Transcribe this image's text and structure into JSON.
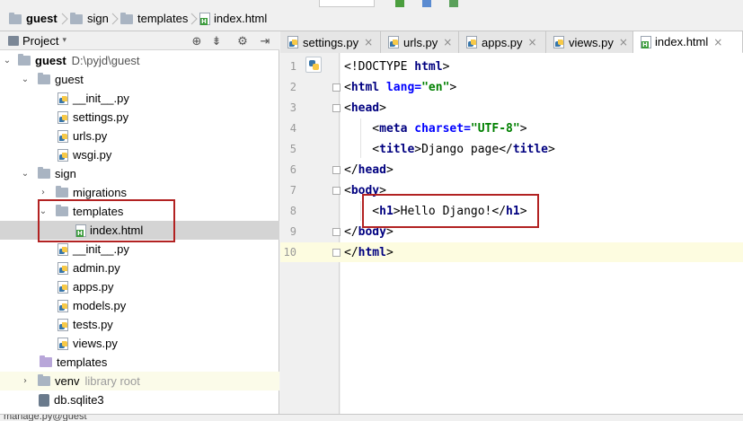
{
  "breadcrumb": {
    "items": [
      {
        "label": "guest",
        "bold": true,
        "icon": "folder-icon"
      },
      {
        "label": "sign",
        "icon": "folder-icon"
      },
      {
        "label": "templates",
        "icon": "folder-icon"
      },
      {
        "label": "index.html",
        "icon": "html-file-icon"
      }
    ]
  },
  "project_panel": {
    "title": "Project",
    "toolbar_icons": [
      "target-icon",
      "collapse-icon",
      "gear-icon",
      "hide-icon"
    ],
    "tree": [
      {
        "label": "guest",
        "extra": "D:\\pyjd\\guest",
        "depth": 0,
        "expanded": true,
        "icon": "folder-icon",
        "bold": true
      },
      {
        "label": "guest",
        "depth": 1,
        "expanded": true,
        "icon": "folder-icon"
      },
      {
        "label": "__init__.py",
        "depth": 2,
        "icon": "python-file-icon"
      },
      {
        "label": "settings.py",
        "depth": 2,
        "icon": "python-file-icon"
      },
      {
        "label": "urls.py",
        "depth": 2,
        "icon": "python-file-icon"
      },
      {
        "label": "wsgi.py",
        "depth": 2,
        "icon": "python-file-icon"
      },
      {
        "label": "sign",
        "depth": 1,
        "expanded": true,
        "icon": "folder-icon"
      },
      {
        "label": "migrations",
        "depth": 2,
        "expanded": false,
        "icon": "folder-icon"
      },
      {
        "label": "templates",
        "depth": 2,
        "expanded": true,
        "icon": "folder-icon"
      },
      {
        "label": "index.html",
        "depth": 3,
        "icon": "html-file-icon",
        "selected": true
      },
      {
        "label": "__init__.py",
        "depth": 2,
        "icon": "python-file-icon"
      },
      {
        "label": "admin.py",
        "depth": 2,
        "icon": "python-file-icon"
      },
      {
        "label": "apps.py",
        "depth": 2,
        "icon": "python-file-icon"
      },
      {
        "label": "models.py",
        "depth": 2,
        "icon": "python-file-icon"
      },
      {
        "label": "tests.py",
        "depth": 2,
        "icon": "python-file-icon"
      },
      {
        "label": "views.py",
        "depth": 2,
        "icon": "python-file-icon"
      },
      {
        "label": "templates",
        "depth": 1,
        "icon": "template-folder-icon"
      },
      {
        "label": "venv",
        "extra": "library root",
        "depth": 1,
        "expanded": false,
        "icon": "folder-icon"
      },
      {
        "label": "db.sqlite3",
        "depth": 1,
        "icon": "database-icon"
      }
    ]
  },
  "tabs": [
    {
      "label": "settings.py",
      "icon": "python-file-icon",
      "close": "×"
    },
    {
      "label": "urls.py",
      "icon": "python-file-icon",
      "close": "×"
    },
    {
      "label": "apps.py",
      "icon": "python-file-icon",
      "close": "×"
    },
    {
      "label": "views.py",
      "icon": "python-file-icon",
      "close": "×"
    },
    {
      "label": "index.html",
      "icon": "html-file-icon",
      "close": "×",
      "active": true
    }
  ],
  "editor": {
    "line_numbers": [
      "1",
      "2",
      "3",
      "4",
      "5",
      "6",
      "7",
      "8",
      "9",
      "10"
    ],
    "lines": [
      [
        {
          "t": "<!DOCTYPE ",
          "c": "txt"
        },
        {
          "t": "html",
          "c": "tag"
        },
        {
          "t": ">",
          "c": "txt"
        }
      ],
      [
        {
          "t": "<",
          "c": "ang"
        },
        {
          "t": "html",
          "c": "tag"
        },
        {
          "t": " ",
          "c": "txt"
        },
        {
          "t": "lang",
          "c": "attr"
        },
        {
          "t": "=",
          "c": "attr"
        },
        {
          "t": "\"en\"",
          "c": "str"
        },
        {
          "t": ">",
          "c": "ang"
        }
      ],
      [
        {
          "t": "<",
          "c": "ang"
        },
        {
          "t": "head",
          "c": "tag"
        },
        {
          "t": ">",
          "c": "ang"
        }
      ],
      [
        {
          "t": "    <",
          "c": "ang"
        },
        {
          "t": "meta",
          "c": "tag"
        },
        {
          "t": " ",
          "c": "txt"
        },
        {
          "t": "charset",
          "c": "attr"
        },
        {
          "t": "=",
          "c": "attr"
        },
        {
          "t": "\"UTF-8\"",
          "c": "str"
        },
        {
          "t": ">",
          "c": "ang"
        }
      ],
      [
        {
          "t": "    <",
          "c": "ang"
        },
        {
          "t": "title",
          "c": "tag"
        },
        {
          "t": ">",
          "c": "ang"
        },
        {
          "t": "Django page",
          "c": "txt"
        },
        {
          "t": "</",
          "c": "ang"
        },
        {
          "t": "title",
          "c": "tag"
        },
        {
          "t": ">",
          "c": "ang"
        }
      ],
      [
        {
          "t": "</",
          "c": "ang"
        },
        {
          "t": "head",
          "c": "tag"
        },
        {
          "t": ">",
          "c": "ang"
        }
      ],
      [
        {
          "t": "<",
          "c": "ang"
        },
        {
          "t": "body",
          "c": "tag"
        },
        {
          "t": ">",
          "c": "ang"
        }
      ],
      [
        {
          "t": "    <",
          "c": "ang"
        },
        {
          "t": "h1",
          "c": "tag"
        },
        {
          "t": ">",
          "c": "ang"
        },
        {
          "t": "Hello Django!",
          "c": "txt"
        },
        {
          "t": "</",
          "c": "ang"
        },
        {
          "t": "h1",
          "c": "tag"
        },
        {
          "t": ">",
          "c": "ang"
        }
      ],
      [
        {
          "t": "</",
          "c": "ang"
        },
        {
          "t": "body",
          "c": "tag"
        },
        {
          "t": ">",
          "c": "ang"
        }
      ],
      [
        {
          "t": "</",
          "c": "ang"
        },
        {
          "t": "html",
          "c": "tag"
        },
        {
          "t": ">",
          "c": "ang"
        }
      ]
    ]
  },
  "status": {
    "text": "manage.py@guest"
  },
  "colors": {
    "annotation_box": "#b22222",
    "caret_line": "#fdfce0",
    "selection": "#d4d4d4"
  }
}
